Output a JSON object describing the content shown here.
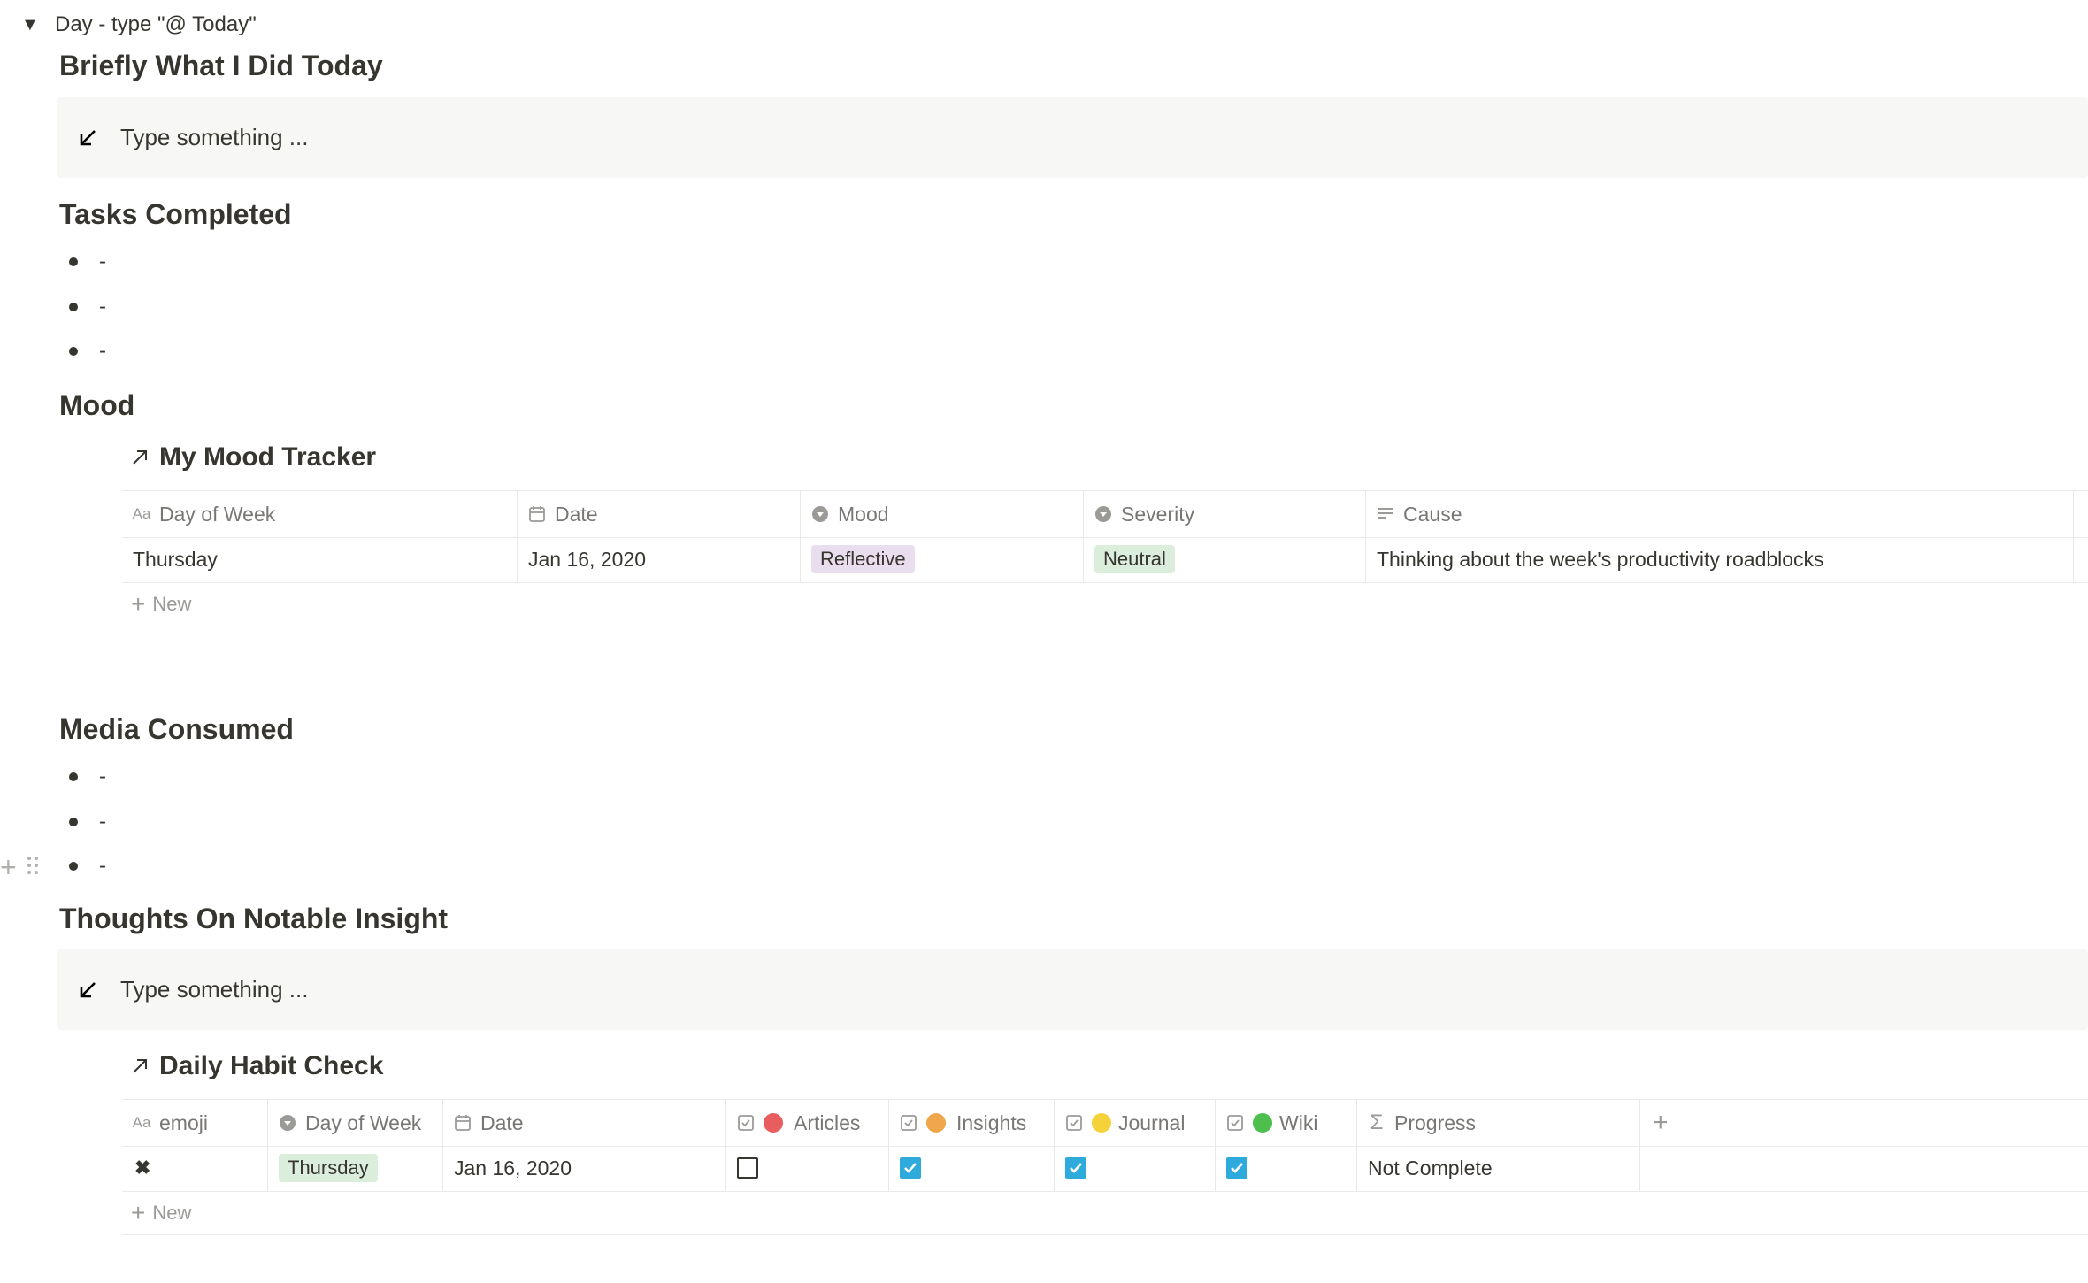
{
  "toggle": {
    "title": "Day - type \"@ Today\""
  },
  "sections": {
    "briefly": {
      "heading": "Briefly What I Did Today",
      "placeholder": "Type something ..."
    },
    "tasks": {
      "heading": "Tasks Completed",
      "items": [
        "-",
        "-",
        "-"
      ]
    },
    "mood": {
      "heading": "Mood"
    },
    "media": {
      "heading": "Media Consumed",
      "items": [
        "-",
        "-",
        "-"
      ]
    },
    "thoughts": {
      "heading": "Thoughts On Notable Insight",
      "placeholder": "Type something ..."
    }
  },
  "mood_tracker": {
    "title": "My Mood Tracker",
    "columns": [
      "Day of Week",
      "Date",
      "Mood",
      "Severity",
      "Cause"
    ],
    "rows": [
      {
        "day": "Thursday",
        "date": "Jan 16, 2020",
        "mood": "Reflective",
        "severity": "Neutral",
        "cause": "Thinking about the week's productivity roadblocks"
      }
    ],
    "new_label": "New",
    "colors": {
      "mood_tag_bg": "#e8deee",
      "severity_tag_bg": "#dbeddb"
    }
  },
  "habit_check": {
    "title": "Daily Habit Check",
    "columns": [
      "emoji",
      "Day of Week",
      "Date",
      "Articles",
      "Insights",
      "Journal",
      "Wiki",
      "Progress"
    ],
    "habit_colors": {
      "Articles": "#e85d5d",
      "Insights": "#f0a64a",
      "Journal": "#f5d23a",
      "Wiki": "#4cbf4c"
    },
    "rows": [
      {
        "emoji": "✖",
        "day": "Thursday",
        "date": "Jan 16, 2020",
        "articles": false,
        "insights": true,
        "journal": true,
        "wiki": true,
        "progress": "Not Complete"
      }
    ],
    "new_label": "New",
    "colors": {
      "checkbox_on": "#2eaadc",
      "day_tag_bg": "#dbeddb"
    }
  },
  "icons": {
    "toggle": "triangle-down-icon",
    "callout": "arrow-down-left-icon",
    "link": "arrow-up-right-icon",
    "add": "plus-icon",
    "drag": "drag-handle-icon"
  }
}
